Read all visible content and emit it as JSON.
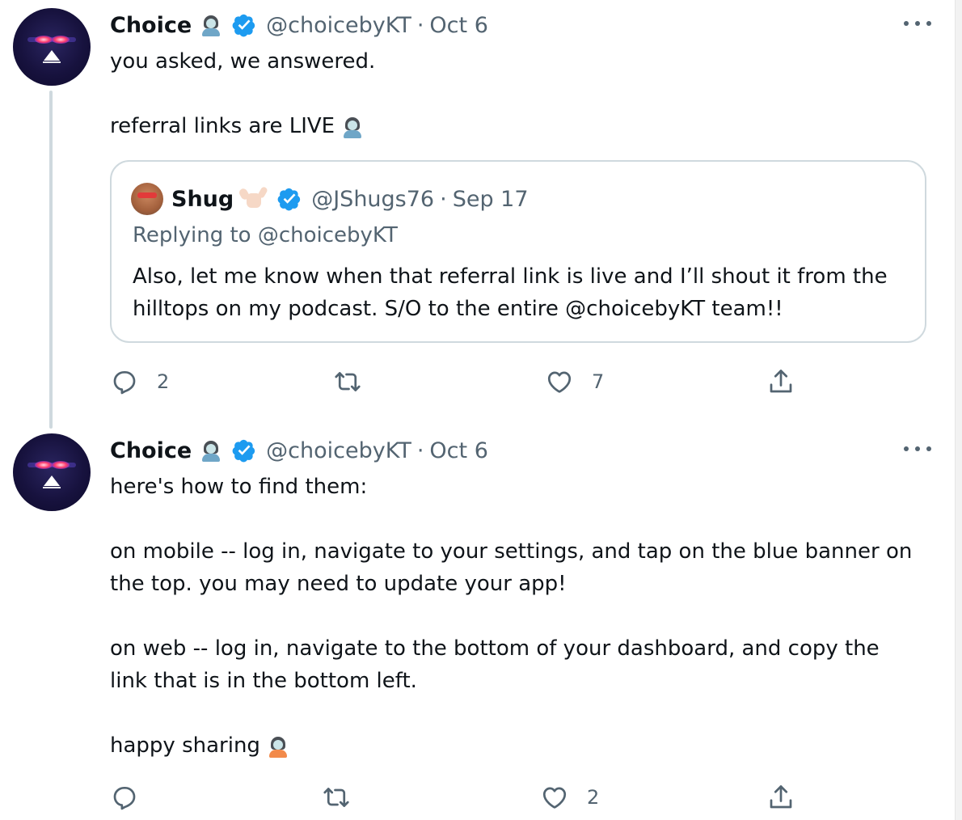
{
  "tweets": [
    {
      "name": "Choice",
      "handle": "@choicebyKT",
      "separator": "·",
      "date": "Oct 6",
      "text_lines": [
        "you asked, we answered.",
        "referral links are LIVE"
      ],
      "quote": {
        "name": "Shug",
        "handle": "@JShugs76",
        "separator": "·",
        "date": "Sep 17",
        "replying_to": "Replying to @choicebyKT",
        "text_lines": [
          "Also, let me know when that referral link is live and I’ll shout it from the",
          "hilltops on my podcast. S/O to the entire @choicebyKT team!!"
        ]
      },
      "actions": {
        "replies": "2",
        "retweets": "",
        "likes": "7"
      }
    },
    {
      "name": "Choice",
      "handle": "@choicebyKT",
      "separator": "·",
      "date": "Oct 6",
      "text_lines": [
        "here's how to find them:",
        "on mobile -- log in, navigate to your settings, and tap on the blue banner on",
        "the top. you may need to update your app!",
        "on web -- log in, navigate to the bottom of your dashboard, and copy the",
        "link that is in the bottom left.",
        "happy sharing"
      ],
      "actions": {
        "replies": "",
        "retweets": "",
        "likes": "2"
      }
    }
  ],
  "colors": {
    "verified": "#1d9bf0",
    "muted": "#536471",
    "border": "#cfd9de",
    "text": "#0f1419"
  },
  "icons": [
    "reply-icon",
    "retweet-icon",
    "like-icon",
    "share-icon",
    "more-icon",
    "verified-badge-icon"
  ]
}
